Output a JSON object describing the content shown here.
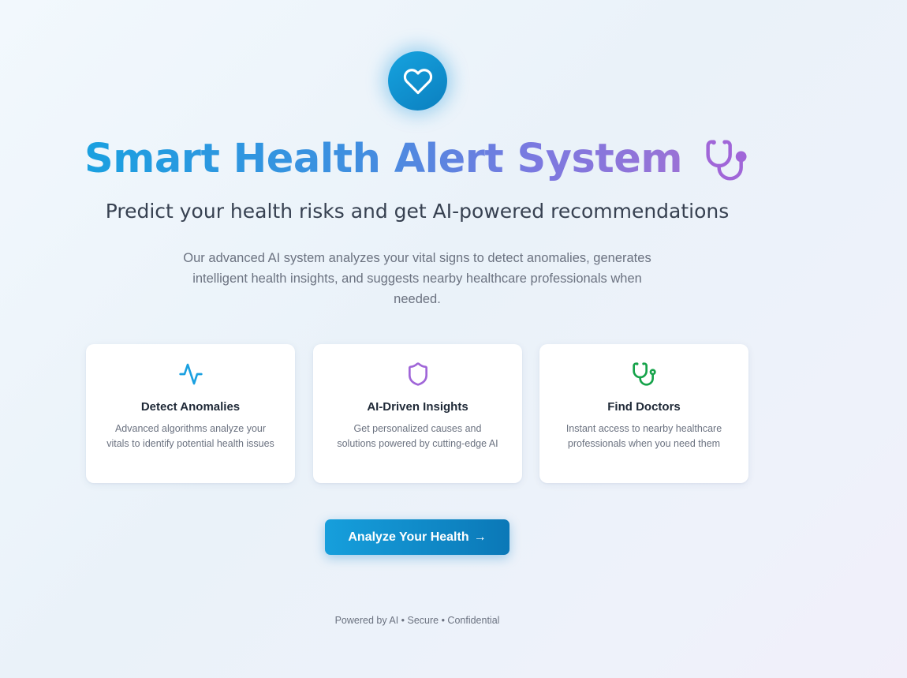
{
  "hero": {
    "icon": "heart-icon",
    "title": "Smart Health Alert System",
    "title_icon": "stethoscope-icon",
    "subtitle": "Predict your health risks and get AI-powered recommendations",
    "description": "Our advanced AI system analyzes your vital signs to detect anomalies, generates intelligent health insights, and suggests nearby healthcare professionals when needed."
  },
  "features": [
    {
      "icon": "activity-icon",
      "icon_color": "#1aa0e0",
      "title": "Detect Anomalies",
      "text": "Advanced algorithms analyze your vitals to identify potential health issues"
    },
    {
      "icon": "shield-icon",
      "icon_color": "#a066d8",
      "title": "AI-Driven Insights",
      "text": "Get personalized causes and solutions powered by cutting-edge AI"
    },
    {
      "icon": "stethoscope-icon",
      "icon_color": "#16a34a",
      "title": "Find Doctors",
      "text": "Instant access to nearby healthcare professionals when you need them"
    }
  ],
  "cta": {
    "label": "Analyze Your Health",
    "arrow": "→"
  },
  "footer": {
    "text": "Powered by AI • Secure • Confidential"
  },
  "colors": {
    "primary": "#169fdc",
    "primary_dark": "#0b78b7",
    "accent_purple": "#9a72d6"
  }
}
